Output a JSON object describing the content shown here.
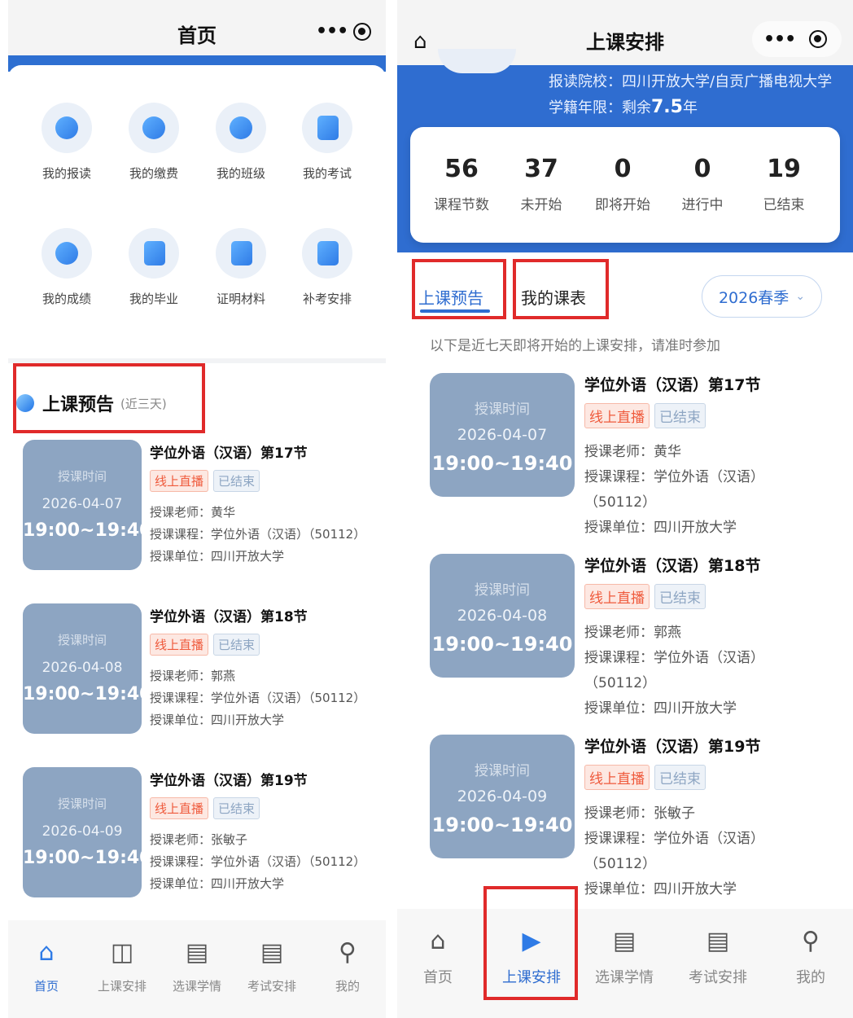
{
  "left": {
    "title": "首页",
    "menu_dots": "•••",
    "grid": [
      {
        "label": "我的报读",
        "icon": "person-icon"
      },
      {
        "label": "我的缴费",
        "icon": "payment-icon"
      },
      {
        "label": "我的班级",
        "icon": "class-icon"
      },
      {
        "label": "我的考试",
        "icon": "exam-icon"
      },
      {
        "label": "我的成绩",
        "icon": "grades-icon"
      },
      {
        "label": "我的毕业",
        "icon": "graduation-icon"
      },
      {
        "label": "证明材料",
        "icon": "document-icon"
      },
      {
        "label": "补考安排",
        "icon": "makeup-exam-icon"
      }
    ],
    "section": {
      "title": "上课预告",
      "subtitle": "(近三天)"
    },
    "tabs": [
      {
        "label": "首页",
        "icon": "home-icon",
        "active": true
      },
      {
        "label": "上课安排",
        "icon": "schedule-icon",
        "active": false
      },
      {
        "label": "选课学情",
        "icon": "course-selection-icon",
        "active": false
      },
      {
        "label": "考试安排",
        "icon": "exam-schedule-icon",
        "active": false
      },
      {
        "label": "我的",
        "icon": "profile-icon",
        "active": false
      }
    ]
  },
  "right": {
    "title": "上课安排",
    "menu_dots": "•••",
    "school": "报读院校：四川开放大学/自贡广播电视大学",
    "years_prefix": "学籍年限：剩余",
    "years_value": "7.5",
    "years_suffix": "年",
    "stats": [
      {
        "value": "56",
        "label": "课程节数"
      },
      {
        "value": "37",
        "label": "未开始"
      },
      {
        "value": "0",
        "label": "即将开始"
      },
      {
        "value": "0",
        "label": "进行中"
      },
      {
        "value": "19",
        "label": "已结束"
      }
    ],
    "tab_preview": "上课预告",
    "tab_my_schedule": "我的课表",
    "semester": "2026春季",
    "hint": "以下是近七天即将开始的上课安排，请准时参加",
    "tabs": [
      {
        "label": "首页",
        "icon": "home-icon",
        "active": false
      },
      {
        "label": "上课安排",
        "icon": "schedule-icon",
        "active": true
      },
      {
        "label": "选课学情",
        "icon": "course-selection-icon",
        "active": false
      },
      {
        "label": "考试安排",
        "icon": "exam-schedule-icon",
        "active": false
      },
      {
        "label": "我的",
        "icon": "profile-icon",
        "active": false
      }
    ]
  },
  "lessons": [
    {
      "time_label": "授课时间",
      "date": "2026-04-07",
      "hours": "19:00~19:40",
      "title": "学位外语（汉语）第17节",
      "tag_live": "线上直播",
      "tag_status": "已结束",
      "teacher": "授课老师：黄华",
      "course_left": "授课课程：学位外语（汉语）（50112）",
      "course_right": "授课课程：学位外语（汉语）",
      "course_code": "（50112）",
      "unit": "授课单位：四川开放大学"
    },
    {
      "time_label": "授课时间",
      "date": "2026-04-08",
      "hours": "19:00~19:40",
      "title": "学位外语（汉语）第18节",
      "tag_live": "线上直播",
      "tag_status": "已结束",
      "teacher": "授课老师：郭燕",
      "course_left": "授课课程：学位外语（汉语）（50112）",
      "course_right": "授课课程：学位外语（汉语）",
      "course_code": "（50112）",
      "unit": "授课单位：四川开放大学"
    },
    {
      "time_label": "授课时间",
      "date": "2026-04-09",
      "hours": "19:00~19:40",
      "title": "学位外语（汉语）第19节",
      "tag_live": "线上直播",
      "tag_status": "已结束",
      "teacher": "授课老师：张敏子",
      "course_left": "授课课程：学位外语（汉语）（50112）",
      "course_right": "授课课程：学位外语（汉语）",
      "course_code": "（50112）",
      "unit": "授课单位：四川开放大学"
    }
  ],
  "colors": {
    "primary": "#2f6dd0",
    "time_block": "#8da5c2",
    "live_tag": "#ef5a3c",
    "highlight_box": "#e02a2a"
  }
}
